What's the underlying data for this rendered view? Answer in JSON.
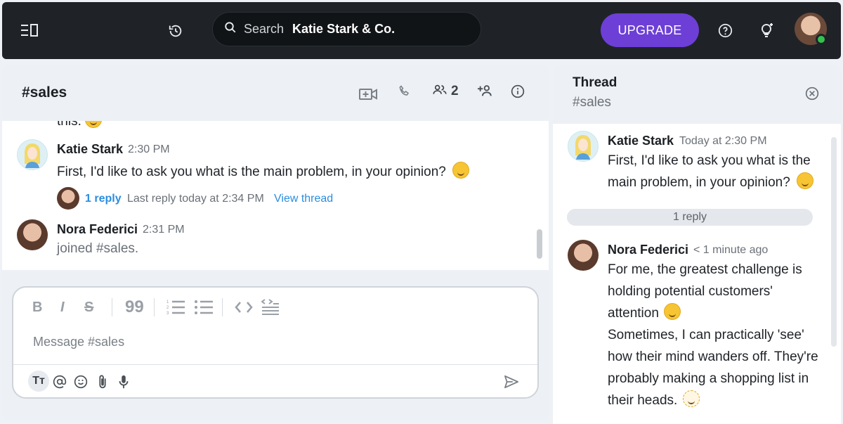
{
  "topbar": {
    "search_placeholder": "Search",
    "workspace": "Katie Stark & Co.",
    "upgrade_label": "UPGRADE"
  },
  "channel": {
    "title": "#sales",
    "member_count": "2",
    "partial_text": "this. "
  },
  "messages": [
    {
      "sender": "Katie Stark",
      "time": "2:30 PM",
      "text": "First, I'd like to ask you what is the main problem, in your opinion?",
      "reply_count": "1 reply",
      "last_reply": "Last reply today at 2:34 PM",
      "view_thread": "View thread"
    },
    {
      "sender": "Nora Federici",
      "time": "2:31 PM",
      "text": "joined #sales."
    }
  ],
  "composer": {
    "placeholder": "Message #sales",
    "tt_label": "Tт"
  },
  "thread": {
    "title": "Thread",
    "channel": "#sales",
    "root": {
      "sender": "Katie Stark",
      "time": "Today at 2:30 PM",
      "text": "First, I'd like to ask you what is the main problem, in your opinion?"
    },
    "reply_pill": "1 reply",
    "reply": {
      "sender": "Nora Federici",
      "time": "< 1 minute ago",
      "text_1": "For me, the greatest challenge is holding potential customers' attention",
      "text_2": "Sometimes, I can practically 'see' how their mind wanders off. They're probably making a shopping list in their heads."
    }
  },
  "colors": {
    "topbar": "#1f2328",
    "upgrade": "#6d3fd6",
    "link": "#2b8de0",
    "presence": "#32c24d"
  }
}
